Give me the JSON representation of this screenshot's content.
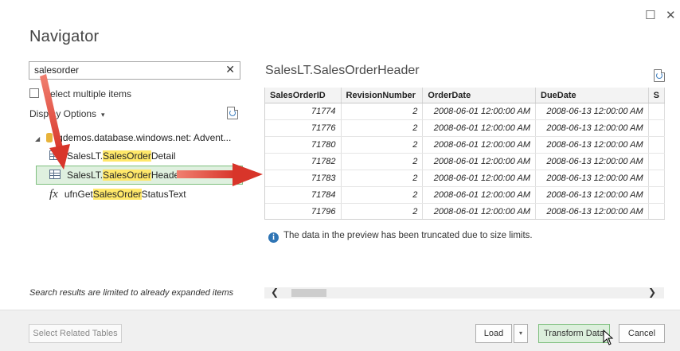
{
  "window": {
    "maximize_glyph": "☐",
    "close_glyph": "✕"
  },
  "title": "Navigator",
  "search": {
    "value": "salesorder",
    "clear_glyph": "✕"
  },
  "options": {
    "select_multiple": "Select multiple items",
    "display_options": "Display Options",
    "display_caret": "▾"
  },
  "tree": {
    "expander": "◢",
    "server": "gdemos.database.windows.net: Advent...",
    "items": [
      {
        "prefix": "SalesLT.",
        "match": "SalesOrder",
        "suffix": "Detail",
        "icon": "table-icon"
      },
      {
        "prefix": "SalesLT.",
        "match": "SalesOrder",
        "suffix": "Header",
        "icon": "table-icon"
      },
      {
        "prefix": "ufnGet",
        "match": "SalesOrder",
        "suffix": "StatusText",
        "icon": "function-icon",
        "icon_text": "fx"
      }
    ]
  },
  "limit_note": "Search results are limited to already expanded items",
  "preview": {
    "title": "SalesLT.SalesOrderHeader",
    "columns": [
      "SalesOrderID",
      "RevisionNumber",
      "OrderDate",
      "DueDate",
      "S"
    ],
    "rows": [
      [
        "71774",
        "2",
        "2008-06-01 12:00:00 AM",
        "2008-06-13 12:00:00 AM",
        ""
      ],
      [
        "71776",
        "2",
        "2008-06-01 12:00:00 AM",
        "2008-06-13 12:00:00 AM",
        ""
      ],
      [
        "71780",
        "2",
        "2008-06-01 12:00:00 AM",
        "2008-06-13 12:00:00 AM",
        ""
      ],
      [
        "71782",
        "2",
        "2008-06-01 12:00:00 AM",
        "2008-06-13 12:00:00 AM",
        ""
      ],
      [
        "71783",
        "2",
        "2008-06-01 12:00:00 AM",
        "2008-06-13 12:00:00 AM",
        ""
      ],
      [
        "71784",
        "2",
        "2008-06-01 12:00:00 AM",
        "2008-06-13 12:00:00 AM",
        ""
      ],
      [
        "71796",
        "2",
        "2008-06-01 12:00:00 AM",
        "2008-06-13 12:00:00 AM",
        ""
      ]
    ],
    "info_text": "The data in the preview has been truncated due to size limits.",
    "info_glyph": "i",
    "scroll_left": "❮",
    "scroll_right": "❯"
  },
  "footer": {
    "select_related": "Select Related Tables",
    "load": "Load",
    "load_caret": "▾",
    "transform": "Transform Data",
    "cancel": "Cancel"
  },
  "colors": {
    "annotation_arrow": "#e8453c",
    "selection_fill": "#dff0df",
    "highlight": "#ffe86a"
  }
}
